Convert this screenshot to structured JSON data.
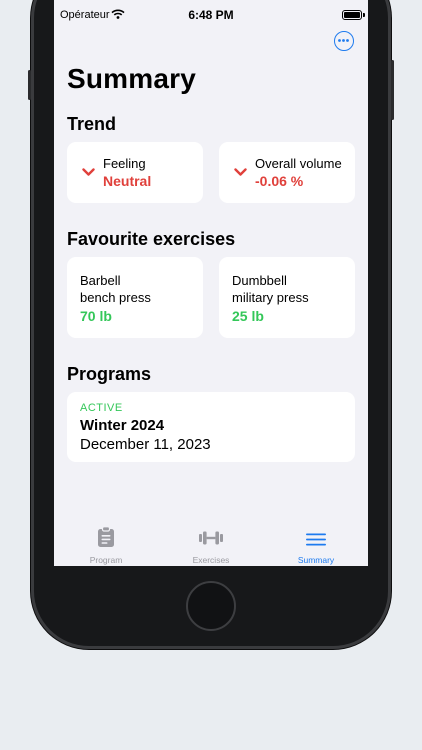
{
  "status_bar": {
    "carrier": "Opérateur",
    "time": "6:48 PM"
  },
  "header": {
    "title": "Summary",
    "more_icon": "ellipsis-circle-icon"
  },
  "trend": {
    "heading": "Trend",
    "cards": [
      {
        "label": "Feeling",
        "value": "Neutral"
      },
      {
        "label": "Overall volume",
        "value": "-0.06 %"
      }
    ]
  },
  "favourites": {
    "heading": "Favourite exercises",
    "cards": [
      {
        "line1": "Barbell",
        "line2": "bench press",
        "weight": "70 lb"
      },
      {
        "line1": "Dumbbell",
        "line2": "military press",
        "weight": "25 lb"
      }
    ]
  },
  "programs": {
    "heading": "Programs",
    "items": [
      {
        "status": "ACTIVE",
        "name": "Winter 2024",
        "date": "December 11, 2023"
      }
    ]
  },
  "tab_bar": {
    "tabs": [
      {
        "label": "Program",
        "icon": "clipboard-icon"
      },
      {
        "label": "Exercises",
        "icon": "dumbbell-icon"
      },
      {
        "label": "Summary",
        "icon": "list-lines-icon"
      }
    ],
    "selected": "Summary"
  },
  "colors": {
    "accent": "#1e7bef",
    "negative": "#e0403b",
    "positive": "#34c759",
    "background": "#f2f2f7"
  }
}
